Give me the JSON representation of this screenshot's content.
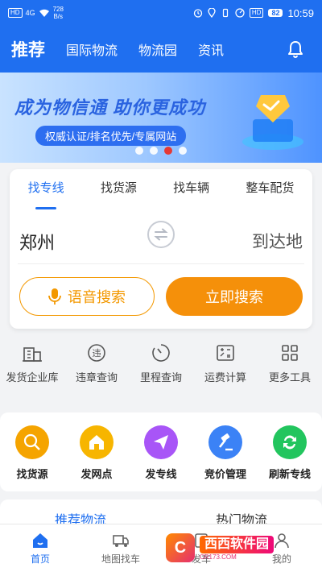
{
  "status_bar": {
    "network_left": "HD",
    "signal": "4G",
    "speed_value": "728",
    "speed_unit": "B/s",
    "network_right": "HD",
    "battery": "82",
    "time": "10:59"
  },
  "header": {
    "tabs": [
      "推荐",
      "国际物流",
      "物流园",
      "资讯"
    ],
    "active_tab": "推荐",
    "bell_icon": "bell-icon"
  },
  "banner": {
    "slogan": "成为物信通 助你更成功",
    "subtitle": "权威认证/排名优先/专属网站",
    "dots_total": 4,
    "dots_active_index": 2,
    "icon": "handshake-icon"
  },
  "search": {
    "tabs": [
      "找专线",
      "找货源",
      "找车辆",
      "整车配货"
    ],
    "active_tab_index": 0,
    "from": "郑州",
    "to": "到达地",
    "voice_button": "语音搜索",
    "search_button": "立即搜索",
    "accent_color": "#f5900a"
  },
  "tools": [
    {
      "label": "发货企业库",
      "icon": "building-icon"
    },
    {
      "label": "违章查询",
      "icon": "violation-icon"
    },
    {
      "label": "里程查询",
      "icon": "odometer-icon"
    },
    {
      "label": "运费计算",
      "icon": "calculator-icon"
    },
    {
      "label": "更多工具",
      "icon": "grid-icon"
    }
  ],
  "quick_actions": [
    {
      "label": "找货源",
      "icon": "search-goods-icon",
      "color": "#f5a400"
    },
    {
      "label": "发网点",
      "icon": "house-icon",
      "color": "#f7b500"
    },
    {
      "label": "发专线",
      "icon": "send-icon",
      "color": "#a855f7"
    },
    {
      "label": "竞价管理",
      "icon": "gavel-icon",
      "color": "#3b82f6"
    },
    {
      "label": "刷新专线",
      "icon": "refresh-icon",
      "color": "#22c55e"
    }
  ],
  "recommend": {
    "tabs": [
      "推荐物流",
      "热门物流"
    ],
    "active_index": 0
  },
  "bottom_nav": {
    "items": [
      {
        "label": "首页",
        "icon": "home-icon"
      },
      {
        "label": "地图找车",
        "icon": "truck-icon"
      },
      {
        "label": "发车",
        "icon": "publish-icon"
      },
      {
        "label": "我的",
        "icon": "user-icon"
      }
    ],
    "active_index": 0
  },
  "watermark": {
    "logo": "C",
    "text": "西西软件园",
    "sub": "CR173.COM"
  },
  "colors": {
    "primary": "#1f6ff0",
    "orange": "#f5900a"
  }
}
